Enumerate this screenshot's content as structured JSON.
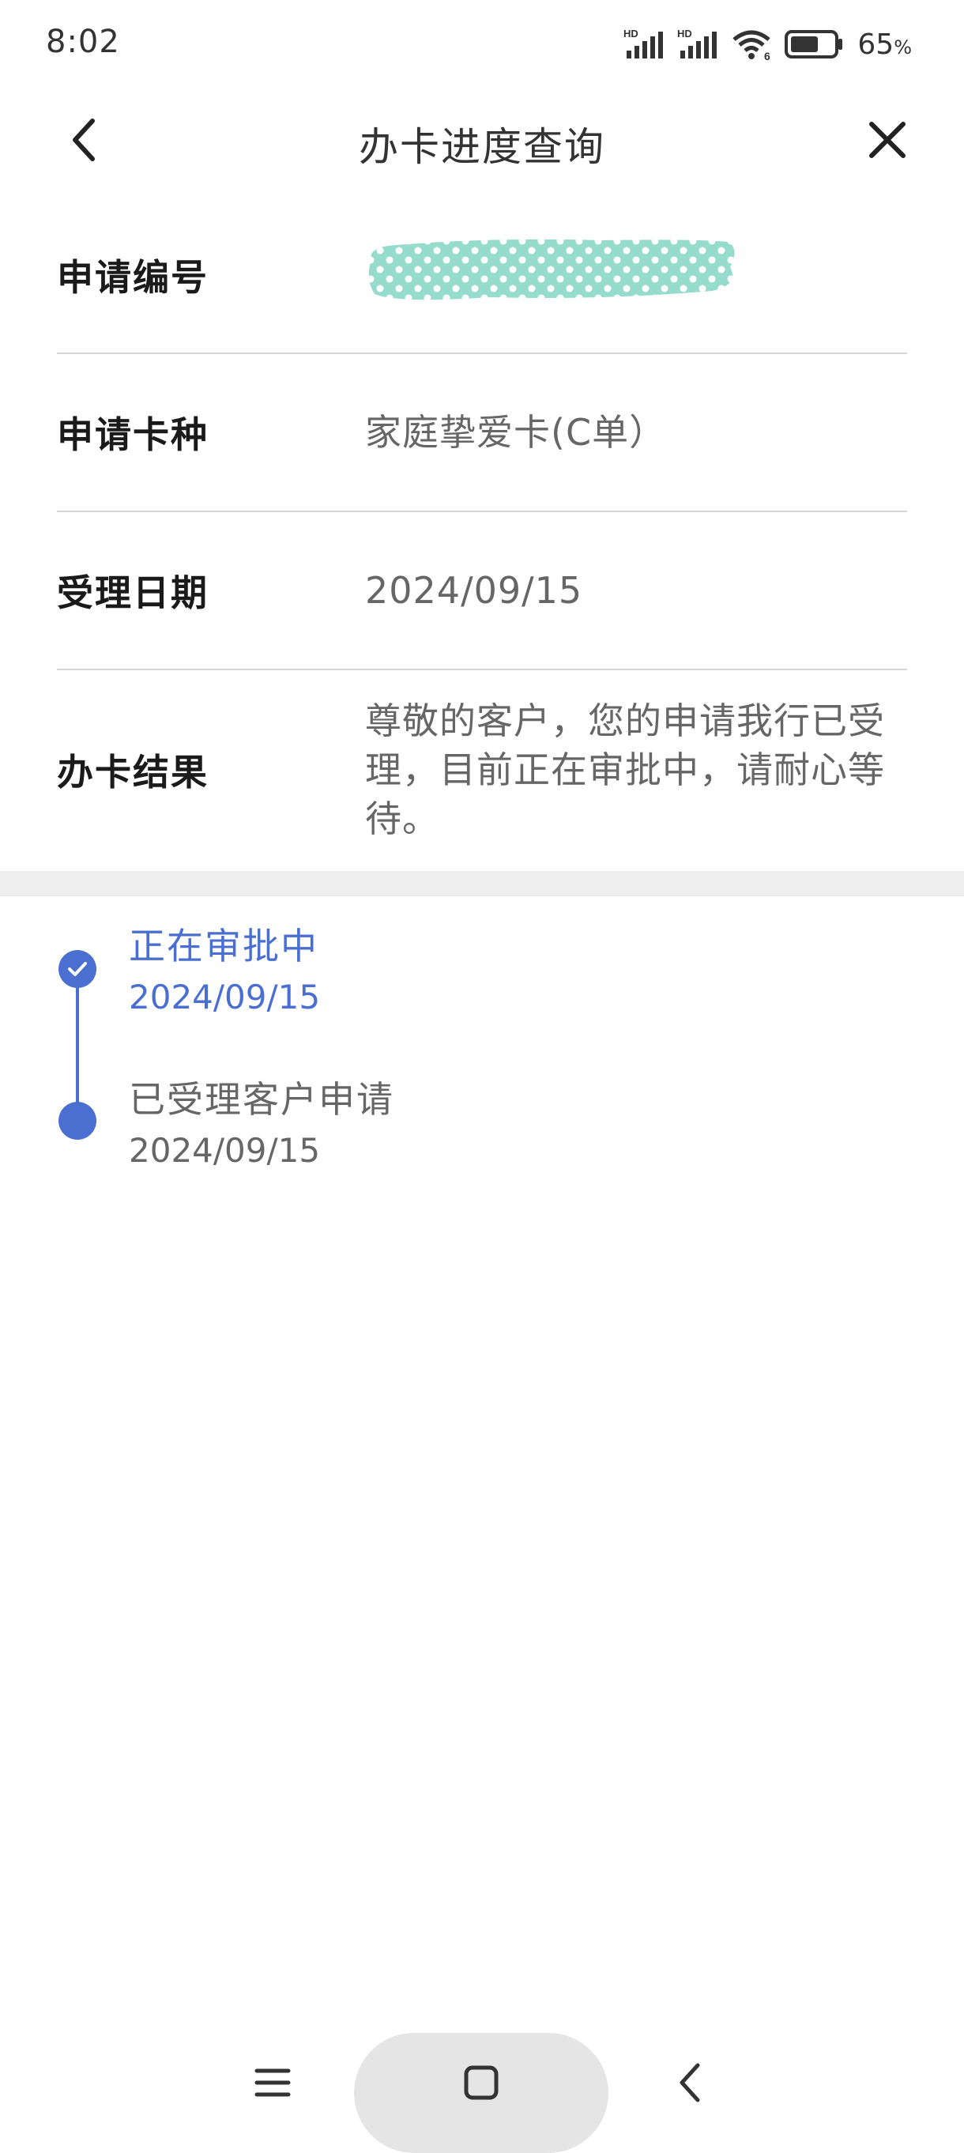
{
  "status_bar": {
    "time": "8:02",
    "signal_1_label": "HD",
    "signal_2_label": "HD",
    "wifi_label": "6",
    "battery_percent": "65",
    "battery_unit": "%",
    "battery_level": 0.65
  },
  "header": {
    "title": "办卡进度查询",
    "back_icon": "chevron-left-icon",
    "close_icon": "close-icon"
  },
  "info": {
    "application_number": {
      "label": "申请编号"
    },
    "card_type": {
      "label": "申请卡种",
      "value": "家庭挚爱卡(C单）"
    },
    "accept_date": {
      "label": "受理日期",
      "value": "2024/09/15"
    },
    "result": {
      "label": "办卡结果",
      "value": "尊敬的客户，您的申请我行已受理，目前正在审批中，请耐心等待。"
    }
  },
  "timeline": {
    "items": [
      {
        "title": "正在审批中",
        "date": "2024/09/15",
        "active": true
      },
      {
        "title": "已受理客户申请",
        "date": "2024/09/15",
        "active": false
      }
    ]
  },
  "colors": {
    "accent": "#4a6fd0",
    "mask": "#96dccd",
    "divider": "#d6d6d6",
    "band": "#eeeeee"
  },
  "nav": {
    "menu_icon": "menu-icon",
    "home_icon": "home-icon",
    "back_icon": "back-icon"
  }
}
